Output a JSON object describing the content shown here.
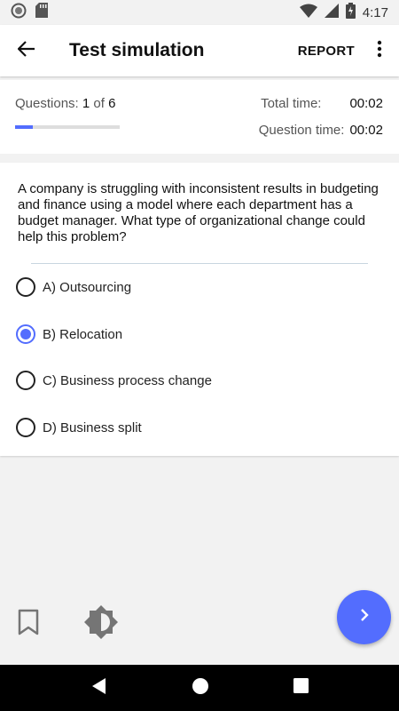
{
  "status_bar": {
    "time": "4:17",
    "icons": [
      "circle-notification-icon",
      "sd-card-icon",
      "wifi-icon",
      "signal-icon",
      "battery-charging-icon"
    ]
  },
  "app_bar": {
    "title": "Test simulation",
    "report_label": "REPORT",
    "icons": [
      "back-arrow-icon",
      "more-vert-icon"
    ]
  },
  "info": {
    "questions_label": "Questions:",
    "current": "1",
    "of_label": "of",
    "total": "6",
    "progress_fraction": 0.167,
    "total_time_label": "Total time:",
    "total_time": "00:02",
    "question_time_label": "Question time:",
    "question_time": "00:02"
  },
  "question": {
    "text": "A company is struggling with inconsistent results in budgeting and finance using a model where each department has a budget manager. What type of organizational change could help this problem?",
    "options": [
      {
        "label": "A) Outsourcing",
        "selected": false
      },
      {
        "label": "B) Relocation",
        "selected": true
      },
      {
        "label": "C) Business process change",
        "selected": false
      },
      {
        "label": "D) Business split",
        "selected": false
      }
    ]
  },
  "bottom": {
    "icons": [
      "bookmark-icon",
      "brightness-icon",
      "next-chevron-icon"
    ]
  },
  "nav_bar": {
    "icons": [
      "nav-back-icon",
      "nav-home-icon",
      "nav-recents-icon"
    ]
  },
  "colors": {
    "accent": "#536dfe",
    "background": "#f2f2f2",
    "card": "#ffffff"
  }
}
